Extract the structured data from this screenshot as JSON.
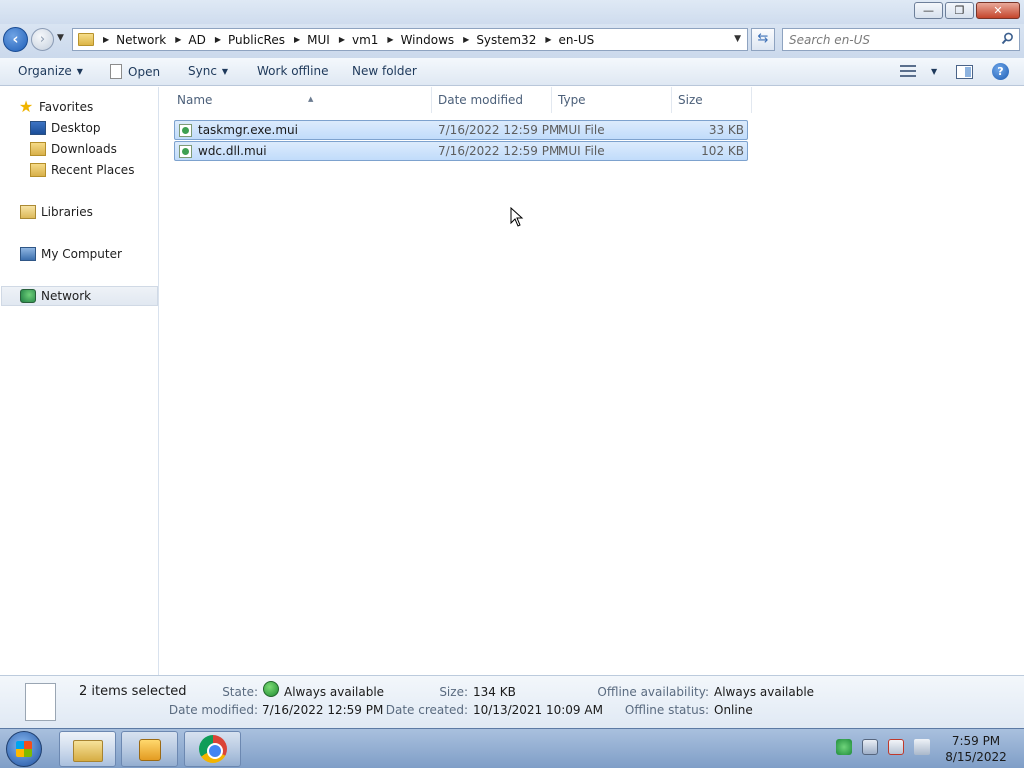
{
  "window": {
    "buttons": {
      "minimize": "—",
      "maximize": "❐",
      "close": "✕"
    }
  },
  "address": {
    "breadcrumb": [
      "Network",
      "AD",
      "PublicRes",
      "MUI",
      "vm1",
      "Windows",
      "System32",
      "en-US"
    ],
    "search_placeholder": "Search en-US"
  },
  "toolbar": {
    "organize": "Organize",
    "open": "Open",
    "sync": "Sync",
    "work_offline": "Work offline",
    "new_folder": "New folder",
    "help": "?"
  },
  "nav": {
    "favorites": "Favorites",
    "desktop": "Desktop",
    "downloads": "Downloads",
    "recent": "Recent Places",
    "libraries": "Libraries",
    "computer": "My Computer",
    "network": "Network"
  },
  "columns": {
    "name": "Name",
    "date": "Date modified",
    "type": "Type",
    "size": "Size"
  },
  "files": [
    {
      "name": "taskmgr.exe.mui",
      "date": "7/16/2022 12:59 PM",
      "type": "MUI File",
      "size": "33 KB"
    },
    {
      "name": "wdc.dll.mui",
      "date": "7/16/2022 12:59 PM",
      "type": "MUI File",
      "size": "102 KB"
    }
  ],
  "details": {
    "selection": "2 items selected",
    "state_label": "State:",
    "state_value": "Always available",
    "size_label": "Size:",
    "size_value": "134 KB",
    "offline_label": "Offline availability:",
    "offline_value": "Always available",
    "date_modified_label": "Date modified:",
    "date_modified_value": "7/16/2022 12:59 PM",
    "date_created_label": "Date created:",
    "date_created_value": "10/13/2021 10:09 AM",
    "offline_status_label": "Offline status:",
    "offline_status_value": "Online"
  },
  "clock": {
    "time": "7:59 PM",
    "date": "8/15/2022"
  }
}
